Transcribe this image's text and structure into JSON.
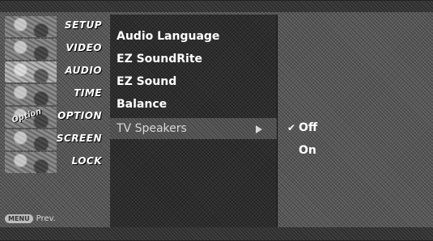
{
  "categories": [
    {
      "label": "SETUP",
      "icon": "setup-thumb-icon"
    },
    {
      "label": "VIDEO",
      "icon": "video-thumb-icon"
    },
    {
      "label": "AUDIO",
      "icon": "audio-thumb-icon",
      "selected": true
    },
    {
      "label": "TIME",
      "icon": "time-thumb-icon"
    },
    {
      "label": "OPTION",
      "icon": "option-thumb-icon",
      "thumb_text": "Option"
    },
    {
      "label": "SCREEN",
      "icon": "screen-thumb-icon"
    },
    {
      "label": "LOCK",
      "icon": "lock-thumb-icon"
    }
  ],
  "footer": {
    "menu_key": "MENU",
    "prev_label": "Prev."
  },
  "submenu": {
    "items": [
      {
        "label": "Audio Language"
      },
      {
        "label": "EZ SoundRite"
      },
      {
        "label": "EZ Sound"
      },
      {
        "label": "Balance"
      },
      {
        "label": "TV Speakers",
        "selected": true
      }
    ]
  },
  "options": {
    "items": [
      {
        "label": "Off",
        "checked": true
      },
      {
        "label": "On",
        "checked": false
      }
    ],
    "check_glyph": "✔"
  },
  "colors": {
    "panel": "#2c2c2c",
    "background": "#5a5a5a",
    "text": "#ffffff"
  }
}
